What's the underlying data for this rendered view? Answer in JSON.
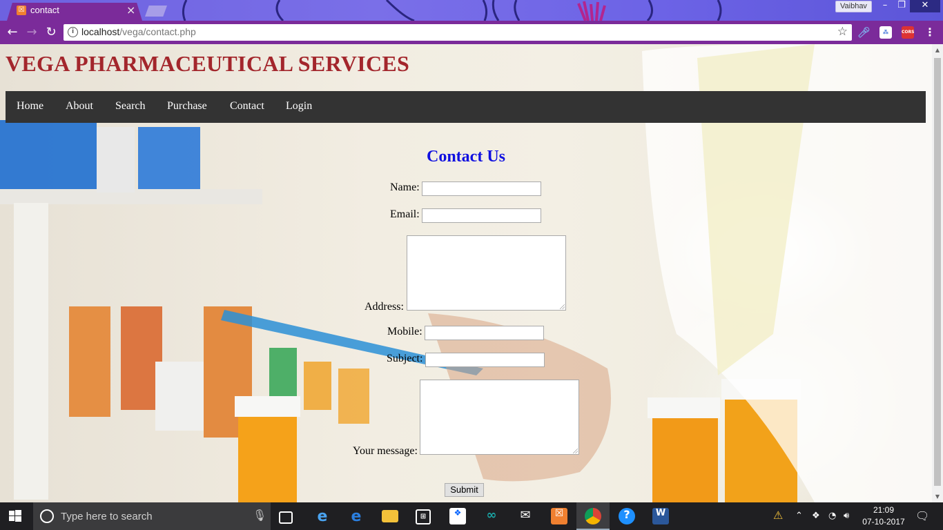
{
  "browser": {
    "tab_title": "contact",
    "tab_favicon": "xampp-icon",
    "profile_name": "Vaibhav",
    "url_host": "localhost",
    "url_path": "/vega/contact.php",
    "colors": {
      "frame": "#7b2b9a",
      "theme_strip": "#6d62e0"
    }
  },
  "site": {
    "title": "VEGA PHARMACEUTICAL SERVICES",
    "title_color": "#a3262c",
    "nav_items": [
      "Home",
      "About",
      "Search",
      "Purchase",
      "Contact",
      "Login"
    ],
    "nav_bg": "#333333"
  },
  "contact_form": {
    "heading": "Contact Us",
    "heading_color": "#1010e0",
    "name_label": "Name:",
    "email_label": "Email:",
    "address_label": "Address:",
    "mobile_label": "Mobile:",
    "subject_label": "Subject:",
    "message_label": "Your message:",
    "name_value": "",
    "email_value": "",
    "address_value": "",
    "mobile_value": "",
    "subject_value": "",
    "message_value": "",
    "submit_label": "Submit"
  },
  "taskbar": {
    "search_placeholder": "Type here to search",
    "apps": [
      "task-view-icon",
      "internet-explorer-icon",
      "edge-icon",
      "file-explorer-icon",
      "store-icon",
      "dropbox-icon",
      "arduino-icon",
      "mail-icon",
      "xampp-icon",
      "chrome-icon",
      "help-icon",
      "word-icon"
    ],
    "clock_time": "21:09",
    "clock_date": "07-10-2017"
  }
}
